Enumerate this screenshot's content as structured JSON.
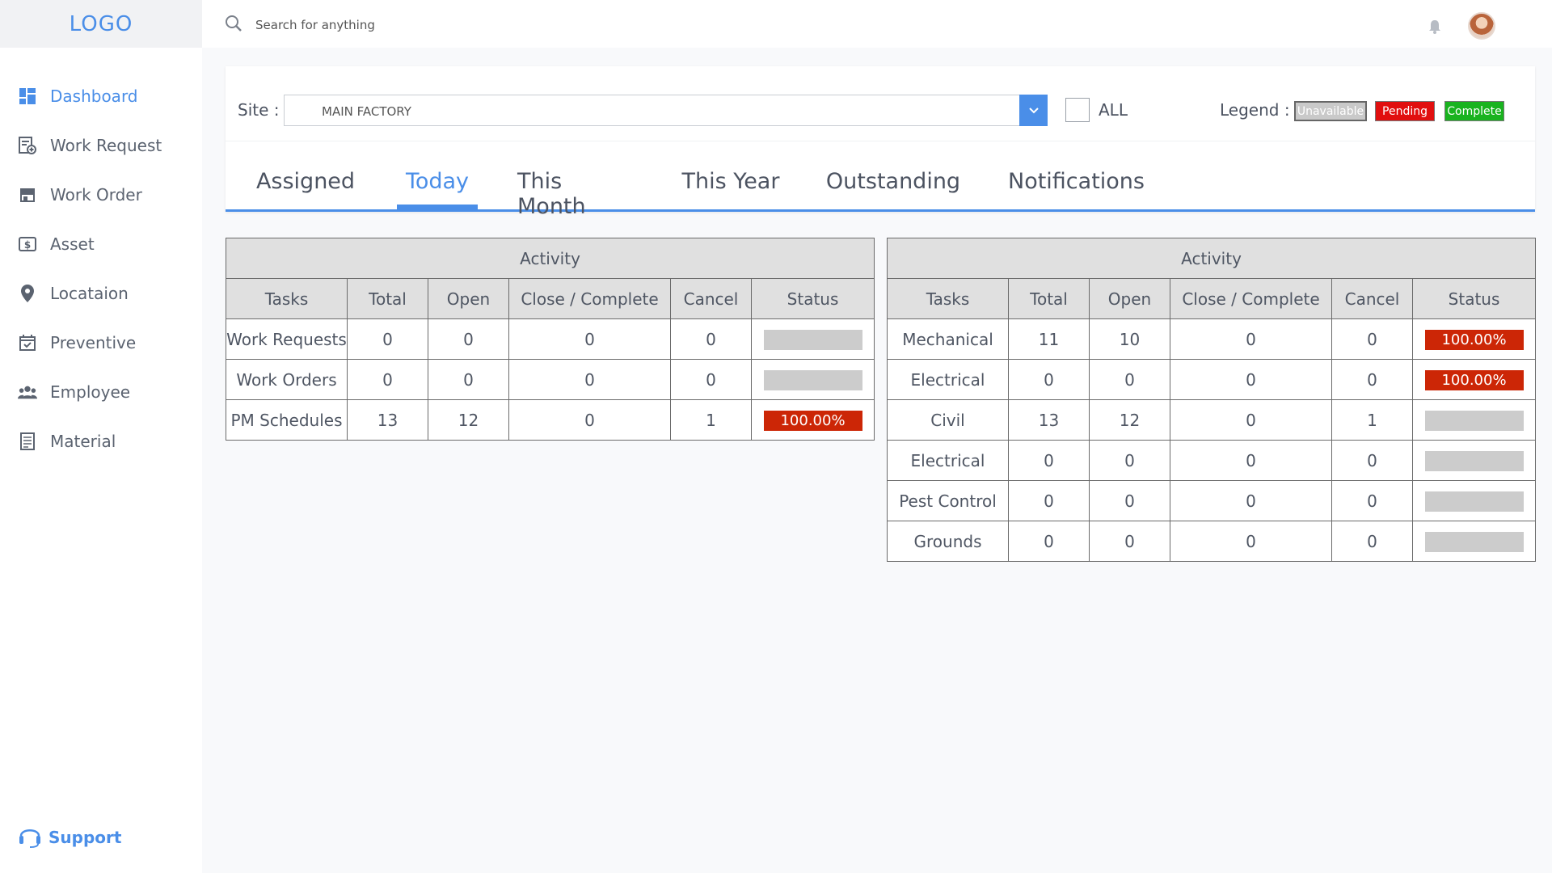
{
  "app": {
    "logo": "LOGO"
  },
  "sidebar": {
    "items": [
      {
        "label": "Dashboard",
        "icon": "dashboard-icon",
        "active": true
      },
      {
        "label": "Work Request",
        "icon": "work-request-icon",
        "active": false
      },
      {
        "label": "Work Order",
        "icon": "work-order-icon",
        "active": false
      },
      {
        "label": "Asset",
        "icon": "asset-icon",
        "active": false
      },
      {
        "label": "Locataion",
        "icon": "location-pin-icon",
        "active": false
      },
      {
        "label": "Preventive",
        "icon": "calendar-check-icon",
        "active": false
      },
      {
        "label": "Employee",
        "icon": "people-icon",
        "active": false
      },
      {
        "label": "Material",
        "icon": "document-icon",
        "active": false
      }
    ],
    "support_label": "Support"
  },
  "topbar": {
    "search_placeholder": "Search for anything",
    "icons": [
      "search-icon",
      "bell-icon",
      "avatar"
    ]
  },
  "filter": {
    "site_label": "Site :",
    "site_value": "MAIN FACTORY",
    "all_label": "ALL",
    "all_checked": false,
    "legend_label": "Legend :",
    "legend": [
      {
        "label": "Unavailable",
        "color": "#c9c9c9"
      },
      {
        "label": "Pending",
        "color": "#e10f0f"
      },
      {
        "label": "Complete",
        "color": "#19b31f"
      }
    ]
  },
  "tabs": [
    {
      "label": "Assigned",
      "active": false
    },
    {
      "label": "Today",
      "active": true
    },
    {
      "label": "This Month",
      "active": false
    },
    {
      "label": "This Year",
      "active": false
    },
    {
      "label": "Outstanding",
      "active": false
    },
    {
      "label": "Notifications",
      "active": false
    }
  ],
  "tables": [
    {
      "title": "Activity",
      "columns": [
        "Tasks",
        "Total",
        "Open",
        "Close / Complete",
        "Cancel",
        "Status"
      ],
      "rows": [
        {
          "task": "Work Requests",
          "total": "0",
          "open": "0",
          "close": "0",
          "cancel": "0",
          "status": ""
        },
        {
          "task": "Work Orders",
          "total": "0",
          "open": "0",
          "close": "0",
          "cancel": "0",
          "status": ""
        },
        {
          "task": "PM Schedules",
          "total": "13",
          "open": "12",
          "close": "0",
          "cancel": "1",
          "status": "100.00%"
        }
      ]
    },
    {
      "title": "Activity",
      "columns": [
        "Tasks",
        "Total",
        "Open",
        "Close / Complete",
        "Cancel",
        "Status"
      ],
      "rows": [
        {
          "task": "Mechanical",
          "total": "11",
          "open": "10",
          "close": "0",
          "cancel": "0",
          "status": "100.00%"
        },
        {
          "task": "Electrical",
          "total": "0",
          "open": "0",
          "close": "0",
          "cancel": "0",
          "status": "100.00%"
        },
        {
          "task": "Civil",
          "total": "13",
          "open": "12",
          "close": "0",
          "cancel": "1",
          "status": ""
        },
        {
          "task": "Electrical",
          "total": "0",
          "open": "0",
          "close": "0",
          "cancel": "0",
          "status": ""
        },
        {
          "task": "Pest Control",
          "total": "0",
          "open": "0",
          "close": "0",
          "cancel": "0",
          "status": ""
        },
        {
          "task": "Grounds",
          "total": "0",
          "open": "0",
          "close": "0",
          "cancel": "0",
          "status": ""
        }
      ]
    }
  ],
  "colors": {
    "accent": "#4a8ee8",
    "status_pending": "#cc2606",
    "status_unavailable": "#cccccc",
    "header_bg": "#e0e0e0"
  }
}
